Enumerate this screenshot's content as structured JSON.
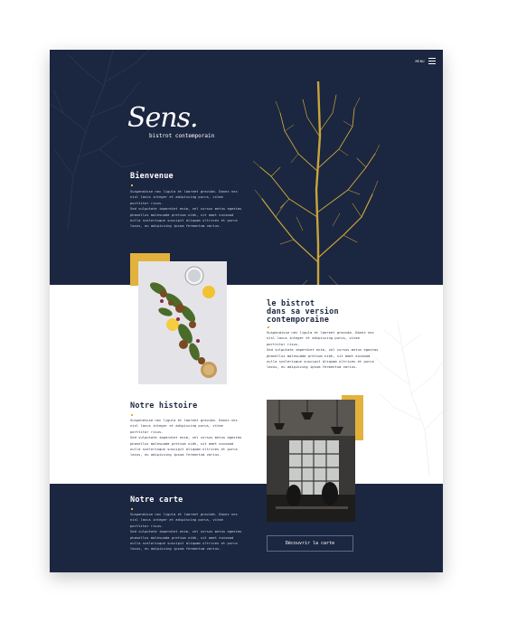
{
  "nav": {
    "menu_label": "MENU"
  },
  "brand": {
    "logo": "Sens.",
    "tagline": "bistrot contemporain"
  },
  "welcome": {
    "title": "Bienvenue",
    "paragraphs": [
      "Suspendisse nec ligula et laoreet gravida. Donec nec nisl lacus integer et adipiscing purus, vitae porttitor risus.",
      "Sed vulputate imperdiet enim, vel cursus metus egestas phasellus malesuada pretium nibh, sit amet euismod nulla scelerisque suscipit aliquam ultrices et purus lacus, eu adipiscing ipsum fermentum varius."
    ]
  },
  "bistrot": {
    "title_lines": [
      "le bistrot",
      "dans sa version",
      "contemporaine"
    ],
    "paragraphs": [
      "Suspendisse nec ligula et laoreet gravida. Donec nec nisl lacus integer et adipiscing purus, vitae porttitor risus.",
      "Sed vulputate imperdiet enim, vel cursus metus egestas phasellus malesuada pretium nibh, sit amet euismod nulla scelerisque suscipit aliquam ultrices et purus lacus, eu adipiscing ipsum fermentum varius."
    ]
  },
  "histoire": {
    "title": "Notre histoire",
    "paragraphs": [
      "Suspendisse nec ligula et laoreet gravida. Donec nec nisl lacus integer et adipiscing purus, vitae porttitor risus.",
      "Sed vulputate imperdiet enim, vel cursus metus egestas phasellus malesuada pretium nibh, sit amet euismod nulla scelerisque suscipit aliquam ultrices et purus lacus, eu adipiscing ipsum fermentum varius."
    ]
  },
  "carte": {
    "title": "Notre carte",
    "paragraphs": [
      "Suspendisse nec ligula et laoreet gravida. Donec nec nisl lacus integer et adipiscing purus, vitae porttitor risus.",
      "Sed vulputate imperdiet enim, vel cursus metus egestas phasellus malesuada pretium nibh, sit amet euismod nulla scelerisque suscipit aliquam ultrices et purus lacus, eu adipiscing ipsum fermentum varius."
    ],
    "cta": "Découvrir la carte"
  },
  "colors": {
    "navy": "#1b2640",
    "gold": "#e3b23c",
    "white": "#ffffff"
  },
  "icons": [
    "hamburger-icon"
  ]
}
